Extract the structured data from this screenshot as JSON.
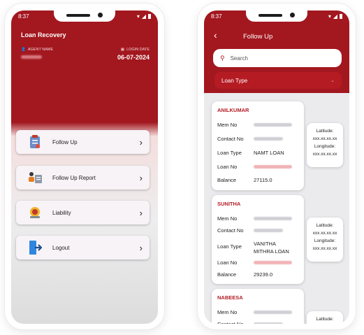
{
  "left": {
    "status_time": "8:37",
    "header_title": "Loan Recovery",
    "agent_label": "AGENT NAME",
    "login_label": "LOGIN DATE",
    "login_date": "06-07-2024",
    "menu": [
      {
        "label": "Follow Up",
        "icon": "clipboard-icon"
      },
      {
        "label": "Follow Up Report",
        "icon": "report-icon"
      },
      {
        "label": "Liability",
        "icon": "money-icon"
      },
      {
        "label": "Logout",
        "icon": "logout-icon"
      }
    ]
  },
  "right": {
    "status_time": "8:37",
    "title": "Follow Up",
    "search_placeholder": "Search",
    "loan_type_label": "Loan Type",
    "labels": {
      "mem": "Mem No",
      "contact": "Contact No",
      "loan_type": "Loan Type",
      "loan_no": "Loan No",
      "balance": "Balance"
    },
    "location": {
      "lat_label": "Latitude:",
      "lat_value": "xxx.xx.xx.xx",
      "lon_label": "Longitude:",
      "lon_value": "xxx.xx.xx.xx"
    },
    "members": [
      {
        "name": "ANILKUMAR",
        "loan_type": "NAMT LOAN",
        "balance": "27115.0"
      },
      {
        "name": "SUNITHA",
        "loan_type": "VANITHA MITHRA LOAN",
        "balance": "29239.0"
      },
      {
        "name": "NABEESA"
      }
    ]
  },
  "colors": {
    "primary": "#a3171f",
    "accent": "#b41c24"
  }
}
